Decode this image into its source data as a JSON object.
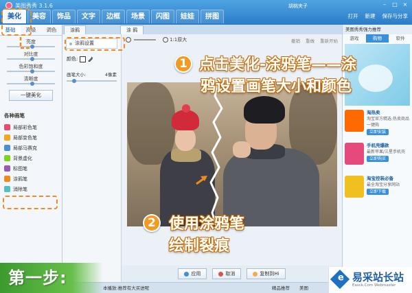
{
  "app": {
    "title": "美图秀秀 3.1.6",
    "user": "胡桃夹子",
    "menu_tabs": [
      "美化",
      "美容",
      "饰品",
      "文字",
      "边框",
      "场景",
      "闪图",
      "娃娃",
      "拼图"
    ],
    "active_menu_tab": "美化",
    "top_actions": [
      "打开",
      "新建",
      "保存与分享"
    ],
    "window_controls": [
      "–",
      "□",
      "×"
    ]
  },
  "left_panel": {
    "subtabs": [
      "基础",
      "高级",
      "调色"
    ],
    "sliders": [
      "亮度",
      "对比度",
      "色彩饱和度",
      "清晰度"
    ],
    "one_key_button": "一键美化",
    "section_title": "各种画笔",
    "tools": [
      {
        "label": "局部彩色笔",
        "color": "#e94b6a"
      },
      {
        "label": "局部变色笔",
        "color": "#f5a623"
      },
      {
        "label": "局部马赛克",
        "color": "#4a90d9"
      },
      {
        "label": "背景虚化",
        "color": "#7ed321"
      },
      {
        "label": "标图笔",
        "color": "#9b59b6"
      },
      {
        "label": "涂鸦笔",
        "color": "#f08a1c"
      },
      {
        "label": "消除笔",
        "color": "#50c0c0"
      }
    ]
  },
  "document_tabs": [
    "涂鸦",
    "涂 鸦"
  ],
  "graffiti_settings": {
    "header": "涂鸦设置",
    "color_label": "颜色:",
    "size_label": "画笔大小:",
    "size_value": "4像素"
  },
  "canvas_toolbar": {
    "original_size": "1:1原大",
    "undo": "撤销",
    "redo": "重做",
    "reset": "重新开始"
  },
  "bottom_buttons": [
    "应用",
    "取消",
    "复制到Hi"
  ],
  "right_panel": {
    "title": "美图秀秀强力推荐",
    "tabs": [
      "游戏",
      "购物",
      "软件"
    ],
    "active_tab": "购物",
    "items": [
      {
        "name": "淘热卖",
        "desc": "淘宝官方精选:热卖商品一键购",
        "action": "立即安装",
        "color": "#ff6a00"
      },
      {
        "name": "手机壳爆款",
        "desc": "最新苹果/三星手机壳",
        "action": "立即购买",
        "color": "#e64a7c"
      },
      {
        "name": "淘宝控装必备",
        "desc": "最全淘宝分享网站",
        "action": "立即下载",
        "color": "#f0c020"
      }
    ]
  },
  "statusbar": {
    "left": "本播放:推荐有大买进呢",
    "right": "精品推荐",
    "tail": "美图"
  },
  "annotations": {
    "step1_number": "1",
    "step1_line1": "点击美化-涂鸦笔——涂",
    "step1_line2": "鸦设置画笔大小和颜色",
    "step2_number": "2",
    "step2_line1": "使用涂鸦笔",
    "step2_line2": "绘制裂痕",
    "step_label": "第一步:"
  },
  "watermark": {
    "cn": "易采站长站",
    "en": "Easck.Com Webmaster"
  }
}
